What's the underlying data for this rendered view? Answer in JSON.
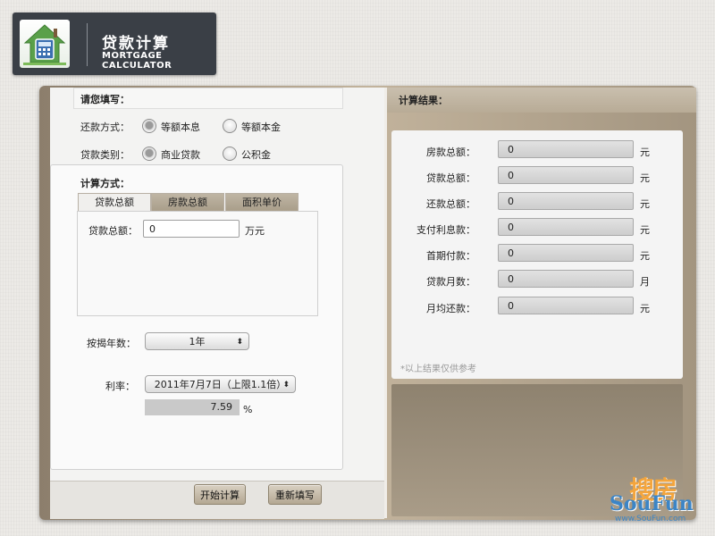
{
  "header": {
    "title_cn": "贷款计算",
    "title_en": "MORTGAGE CALCULATOR"
  },
  "form": {
    "fill_in_label": "请您填写：",
    "repayment": {
      "label": "还款方式：",
      "options": [
        "等额本息",
        "等额本金"
      ],
      "selected": 0
    },
    "loan_type": {
      "label": "贷款类别：",
      "options": [
        "商业贷款",
        "公积金"
      ],
      "selected": 0
    },
    "calc_method_label": "计算方式：",
    "tabs": [
      "贷款总额",
      "房款总额",
      "面积单价"
    ],
    "active_tab": 0,
    "loan_total": {
      "label": "贷款总额：",
      "value": "0",
      "unit": "万元"
    },
    "years": {
      "label": "按揭年数：",
      "value": "1年"
    },
    "rate": {
      "label": "利率：",
      "value": "2011年7月7日（上限1.1倍）",
      "rate_value": "7.59",
      "unit": "%"
    },
    "buttons": {
      "calculate": "开始计算",
      "reset": "重新填写"
    }
  },
  "results": {
    "title": "计算结果：",
    "rows": [
      {
        "label": "房款总额：",
        "value": "0",
        "unit": "元"
      },
      {
        "label": "贷款总额：",
        "value": "0",
        "unit": "元"
      },
      {
        "label": "还款总额：",
        "value": "0",
        "unit": "元"
      },
      {
        "label": "支付利息款：",
        "value": "0",
        "unit": "元"
      },
      {
        "label": "首期付款：",
        "value": "0",
        "unit": "元"
      },
      {
        "label": "贷款月数：",
        "value": "0",
        "unit": "月"
      },
      {
        "label": "月均还款：",
        "value": "0",
        "unit": "元"
      }
    ],
    "note": "*以上结果仅供参考"
  },
  "watermark": {
    "cn": "搜房",
    "en": "SouFun",
    "url": "www.SouFun.com"
  },
  "icons": {
    "logo": "house-calculator-icon"
  }
}
